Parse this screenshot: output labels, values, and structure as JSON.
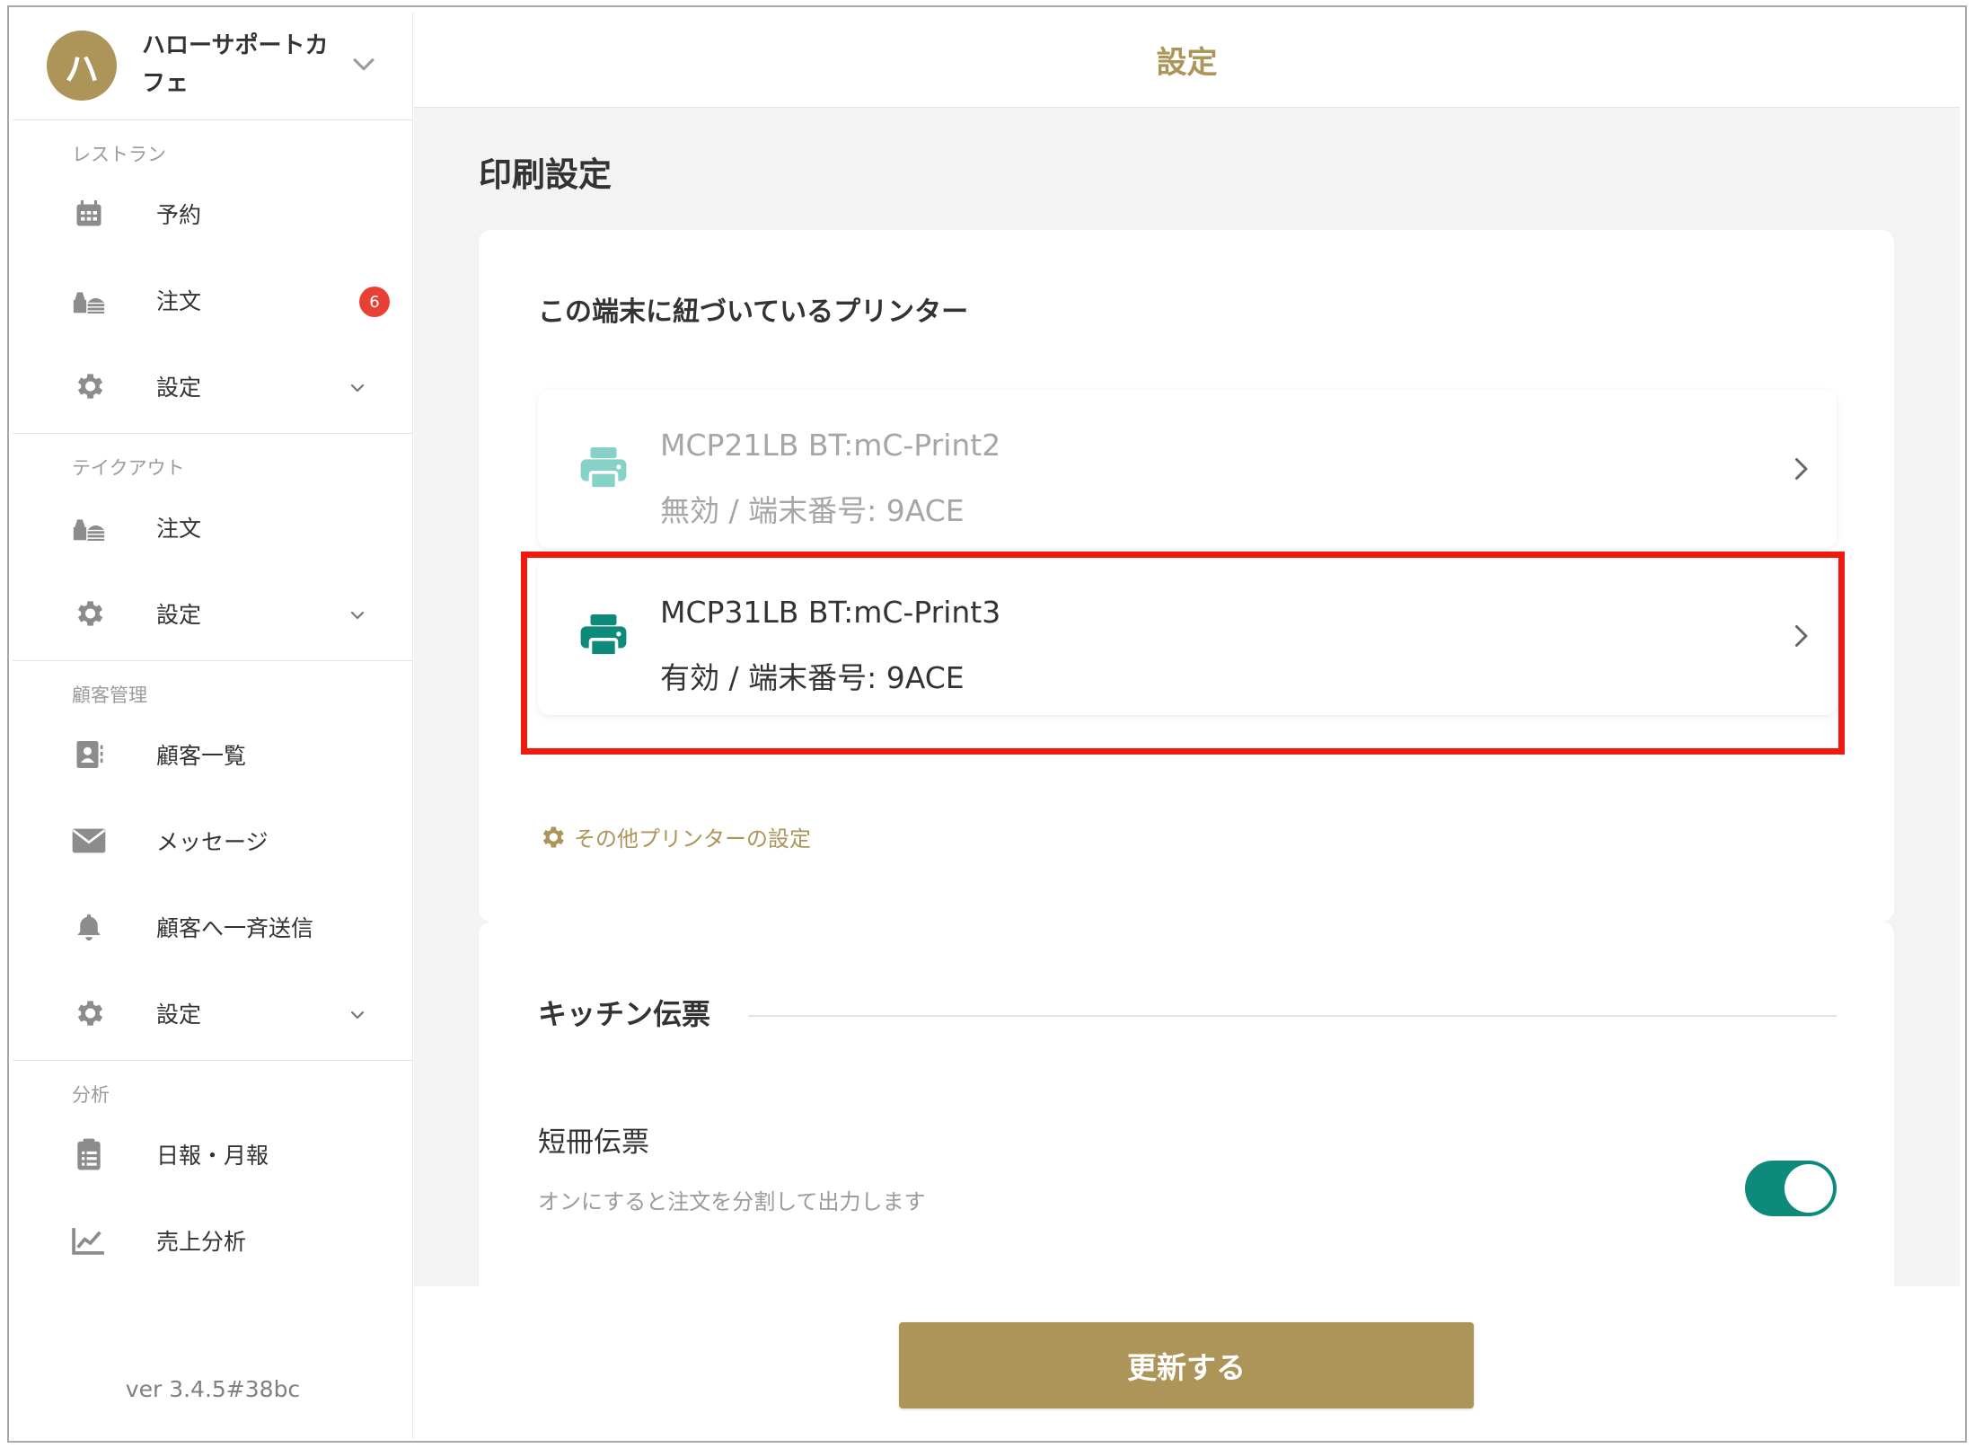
{
  "shop": {
    "avatar_initial": "ハ",
    "name": "ハローサポートカフェ"
  },
  "sidebar": {
    "sections": [
      {
        "label": "レストラン",
        "items": [
          {
            "label": "予約",
            "icon": "calendar-icon"
          },
          {
            "label": "注文",
            "icon": "order-tray-icon",
            "badge": "6"
          },
          {
            "label": "設定",
            "icon": "gear-icon",
            "expandable": true
          }
        ]
      },
      {
        "label": "テイクアウト",
        "items": [
          {
            "label": "注文",
            "icon": "order-tray-icon"
          },
          {
            "label": "設定",
            "icon": "gear-icon",
            "expandable": true
          }
        ]
      },
      {
        "label": "顧客管理",
        "items": [
          {
            "label": "顧客一覧",
            "icon": "contact-card-icon"
          },
          {
            "label": "メッセージ",
            "icon": "envelope-icon"
          },
          {
            "label": "顧客へ一斉送信",
            "icon": "bell-icon"
          },
          {
            "label": "設定",
            "icon": "gear-icon",
            "expandable": true
          }
        ]
      },
      {
        "label": "分析",
        "items": [
          {
            "label": "日報・月報",
            "icon": "clipboard-icon"
          },
          {
            "label": "売上分析",
            "icon": "line-chart-icon"
          }
        ]
      }
    ],
    "version": "ver 3.4.5#38bc"
  },
  "header": {
    "title": "設定"
  },
  "page": {
    "title": "印刷設定"
  },
  "printers": {
    "heading": "この端末に紐づいているプリンター",
    "items": [
      {
        "name": "MCP21LB BT:mC-Print2",
        "status": "無効 / 端末番号: 9ACE",
        "enabled": false
      },
      {
        "name": "MCP31LB BT:mC-Print3",
        "status": "有効 / 端末番号: 9ACE",
        "enabled": true
      }
    ],
    "other_link": "その他プリンターの設定"
  },
  "kitchen": {
    "heading": "キッチン伝票",
    "slip_label": "短冊伝票",
    "slip_desc": "オンにすると注文を分割して出力します",
    "slip_enabled": true
  },
  "footer": {
    "update_label": "更新する"
  },
  "colors": {
    "brand": "#ad955a",
    "teal": "#0e8a7a",
    "teal_disabled": "#86d2c6",
    "badge": "#e84035",
    "highlight": "#f0190e"
  }
}
